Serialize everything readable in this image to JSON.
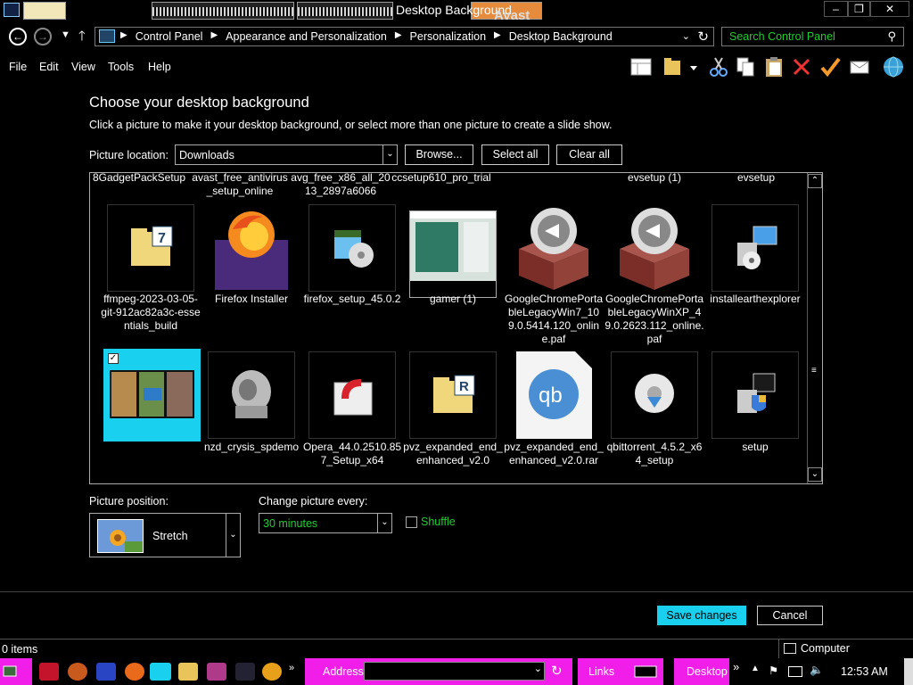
{
  "window": {
    "title": "Desktop Background",
    "overlay_text": "Avast",
    "minimize": "–",
    "maximize": "❐",
    "close": "✕"
  },
  "address": {
    "crumbs": [
      "Control Panel",
      "Appearance and Personalization",
      "Personalization",
      "Desktop Background"
    ],
    "search_placeholder": "Search Control Panel"
  },
  "menu": [
    "File",
    "Edit",
    "View",
    "Tools",
    "Help"
  ],
  "page": {
    "heading": "Choose your desktop background",
    "subheading": "Click a picture to make it your desktop background, or select more than one picture to create a slide show.",
    "location_label": "Picture location:",
    "location_value": "Downloads",
    "browse": "Browse...",
    "select_all": "Select all",
    "clear_all": "Clear all"
  },
  "gallery": {
    "row0": [
      "8GadgetPackSetup",
      "avast_free_antivirus_setup_online",
      "avg_free_x86_all_2013_2897a6066",
      "ccsetup610_pro_trial",
      "",
      "evsetup (1)",
      "evsetup"
    ],
    "row1": [
      "ffmpeg-2023-03-05-git-912ac82a3c-essentials_build",
      "Firefox Installer",
      "firefox_setup_45.0.2",
      "gamer (1)",
      "GoogleChromePortableLegacyWin7_109.0.5414.120_online.paf",
      "GoogleChromePortableLegacyWinXP_49.0.2623.112_online.paf",
      "installearthexplorer"
    ],
    "row2": [
      "",
      "nzd_crysis_spdemo",
      "Opera_44.0.2510.857_Setup_x64",
      "pvz_expanded_end_enhanced_v2.0",
      "pvz_expanded_end_enhanced_v2.0.rar",
      "qbittorrent_4.5.2_x64_setup",
      "setup"
    ],
    "selected_checkmark": "✓"
  },
  "settings": {
    "position_label": "Picture position:",
    "position_value": "Stretch",
    "change_label": "Change picture every:",
    "change_value": "30 minutes",
    "shuffle_label": "Shuffle",
    "shuffle_checked": false
  },
  "actions": {
    "save": "Save changes",
    "cancel": "Cancel"
  },
  "status": {
    "items": "0 items",
    "location": "Computer"
  },
  "taskbar": {
    "address_label": "Address",
    "links_label": "Links",
    "desktop_label": "Desktop",
    "overflow": "»",
    "clock": "12:53 AM"
  },
  "colors": {
    "accent": "#f01ee8",
    "selection": "#1ad0ef",
    "green_text": "#22cc33"
  }
}
